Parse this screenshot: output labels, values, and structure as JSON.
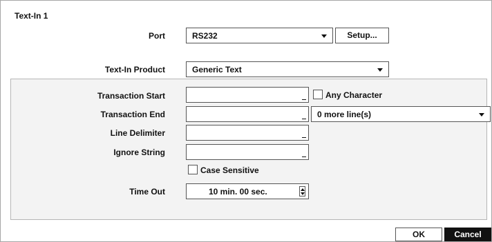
{
  "dialog": {
    "title": "Text-In 1"
  },
  "port": {
    "label": "Port",
    "value": "RS232",
    "setup_label": "Setup..."
  },
  "product": {
    "label": "Text-In Product",
    "value": "Generic Text"
  },
  "transaction_start": {
    "label": "Transaction Start",
    "value": "",
    "any_character_label": "Any Character"
  },
  "transaction_end": {
    "label": "Transaction End",
    "value": "",
    "lines_value": "0 more line(s)"
  },
  "line_delimiter": {
    "label": "Line Delimiter",
    "value": ""
  },
  "ignore_string": {
    "label": "Ignore String",
    "value": ""
  },
  "case_sensitive": {
    "label": "Case Sensitive"
  },
  "time_out": {
    "label": "Time Out",
    "value": "10 min. 00 sec."
  },
  "footer": {
    "ok_label": "OK",
    "cancel_label": "Cancel"
  },
  "icons": {
    "dropdown": "chevron-down-icon",
    "spinner": "spinner-arrows-icon",
    "checkbox": "checkbox-icon"
  },
  "colors": {
    "primary_button_bg": "#111111",
    "panel_bg": "#f3f3f3"
  }
}
